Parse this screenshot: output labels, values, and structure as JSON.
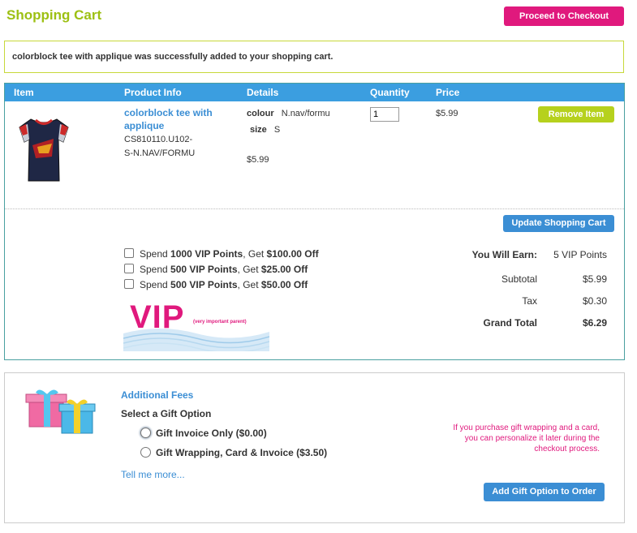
{
  "header": {
    "title": "Shopping Cart",
    "checkout_label": "Proceed to Checkout"
  },
  "notice": "colorblock tee with applique was successfully added to your shopping cart.",
  "table": {
    "headers": [
      "Item",
      "Product Info",
      "Details",
      "Quantity",
      "Price"
    ]
  },
  "item": {
    "name_line1": "colorblock tee with",
    "name_line2": "applique",
    "sku_line1": "CS810110.U102-",
    "sku_line2": "S-N.NAV/FORMU",
    "colour_label": "colour",
    "colour_value": "N.nav/formu",
    "size_label": "size",
    "size_value": "S",
    "detail_price": "$5.99",
    "quantity": "1",
    "price": "$5.99",
    "remove_label": "Remove Item"
  },
  "update_label": "Update Shopping Cart",
  "vip_offers": [
    {
      "pre": "Spend ",
      "points": "1000 VIP Points",
      "mid": ", Get ",
      "amount": "$100.00 Off"
    },
    {
      "pre": "Spend ",
      "points": "500 VIP Points",
      "mid": ", Get ",
      "amount": "$25.00 Off"
    },
    {
      "pre": "Spend ",
      "points": "500 VIP Points",
      "mid": ", Get ",
      "amount": "$50.00 Off"
    }
  ],
  "vip_logo": {
    "text": "VIP",
    "subtext": "(very important parent)"
  },
  "totals": {
    "earn_label": "You Will Earn:",
    "earn_value": "5 VIP Points",
    "subtotal_label": "Subtotal",
    "subtotal_value": "$5.99",
    "tax_label": "Tax",
    "tax_value": "$0.30",
    "grand_label": "Grand Total",
    "grand_value": "$6.29"
  },
  "gift": {
    "title": "Additional Fees",
    "select_label": "Select a Gift Option",
    "options": [
      {
        "label": "Gift Invoice Only ($0.00)",
        "selected": true
      },
      {
        "label": "Gift Wrapping, Card & Invoice ($3.50)",
        "selected": false
      }
    ],
    "tell_more": "Tell me more...",
    "note_line1": "If you purchase gift wrapping and a card,",
    "note_line2": "you can personalize it later during the",
    "note_line3": "checkout process.",
    "add_label": "Add Gift Option to Order"
  },
  "colors": {
    "green": "#9dc013",
    "pink": "#e0197d",
    "blue": "#3b8ed4",
    "header_blue": "#3b9ee0"
  }
}
